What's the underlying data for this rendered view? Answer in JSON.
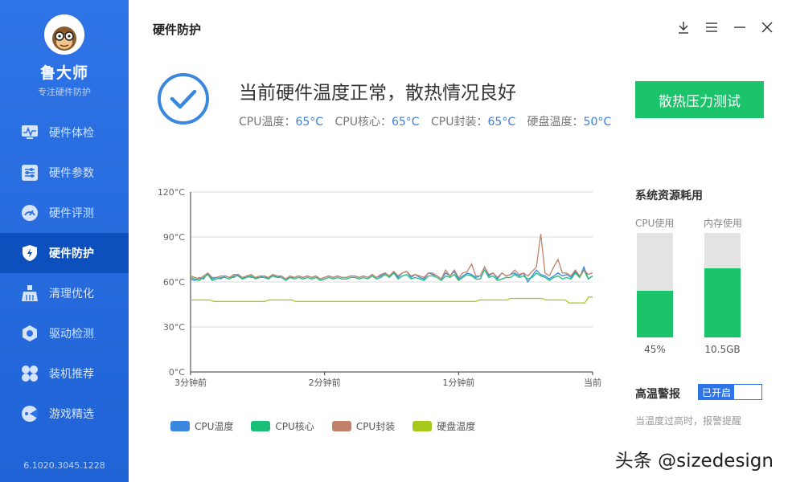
{
  "sidebar": {
    "app_name": "鲁大师",
    "app_subtitle": "专注硬件防护",
    "items": [
      {
        "label": "硬件体检",
        "icon": "monitor-icon"
      },
      {
        "label": "硬件参数",
        "icon": "sliders-icon"
      },
      {
        "label": "硬件评测",
        "icon": "gauge-icon"
      },
      {
        "label": "硬件防护",
        "icon": "shield-icon",
        "active": true
      },
      {
        "label": "清理优化",
        "icon": "broom-icon"
      },
      {
        "label": "驱动检测",
        "icon": "gear-icon"
      },
      {
        "label": "装机推荐",
        "icon": "grid-icon"
      },
      {
        "label": "游戏精选",
        "icon": "game-icon"
      }
    ],
    "version": "6.1020.3045.1228"
  },
  "header": {
    "title": "硬件防护"
  },
  "status": {
    "title": "当前硬件温度正常，散热情况良好",
    "temps": [
      {
        "label": "CPU温度：",
        "value": "65°C"
      },
      {
        "label": "CPU核心：",
        "value": "65°C"
      },
      {
        "label": "CPU封装：",
        "value": "65°C"
      },
      {
        "label": "硬盘温度：",
        "value": "50°C"
      }
    ],
    "stress_button": "散热压力测试"
  },
  "chart_data": {
    "type": "line",
    "y_ticks": [
      "120°C",
      "90°C",
      "60°C",
      "30°C",
      "0°C"
    ],
    "x_ticks": [
      "3分钟前",
      "2分钟前",
      "1分钟前",
      "当前"
    ],
    "ylim": [
      0,
      120
    ],
    "grid": true,
    "legend_position": "bottom",
    "series": [
      {
        "name": "CPU温度",
        "color": "#3a87e0",
        "values": [
          62,
          61,
          63,
          62,
          66,
          62,
          63,
          62,
          64,
          63,
          63,
          65,
          62,
          64,
          63,
          63,
          63,
          64,
          62,
          65,
          63,
          64,
          62,
          63,
          63,
          64,
          63,
          64,
          63,
          64,
          62,
          63,
          64,
          63,
          64,
          63,
          63,
          64,
          64,
          63,
          64,
          63,
          65,
          63,
          64,
          66,
          64,
          67,
          63,
          66,
          67,
          63,
          65,
          63,
          62,
          66,
          65,
          64,
          62,
          66,
          64,
          67,
          62,
          64,
          66,
          65,
          63,
          64,
          70,
          64,
          66,
          62,
          66,
          64,
          65,
          66,
          64,
          66,
          60,
          64,
          68,
          65,
          64,
          62,
          64,
          66,
          64,
          65,
          63,
          67,
          63,
          70,
          62,
          64
        ]
      },
      {
        "name": "CPU核心",
        "color": "#1bbf78",
        "values": [
          63,
          62,
          61,
          63,
          65,
          61,
          62,
          63,
          63,
          62,
          64,
          64,
          62,
          63,
          64,
          62,
          63,
          63,
          62,
          64,
          63,
          63,
          61,
          63,
          62,
          63,
          62,
          63,
          62,
          63,
          61,
          62,
          63,
          62,
          63,
          62,
          62,
          63,
          63,
          62,
          63,
          62,
          64,
          62,
          63,
          65,
          63,
          66,
          62,
          64,
          65,
          62,
          63,
          62,
          61,
          64,
          64,
          63,
          61,
          64,
          63,
          65,
          61,
          63,
          65,
          64,
          62,
          62,
          68,
          63,
          64,
          61,
          62,
          63,
          63,
          65,
          63,
          64,
          62,
          63,
          66,
          64,
          63,
          61,
          63,
          64,
          62,
          63,
          62,
          66,
          63,
          68,
          62,
          64
        ]
      },
      {
        "name": "CPU封装",
        "color": "#c0826a",
        "values": [
          64,
          63,
          62,
          64,
          66,
          63,
          63,
          64,
          64,
          63,
          65,
          65,
          63,
          64,
          65,
          63,
          64,
          64,
          63,
          65,
          64,
          64,
          62,
          64,
          63,
          64,
          63,
          64,
          63,
          64,
          62,
          63,
          64,
          63,
          64,
          63,
          63,
          64,
          64,
          63,
          64,
          63,
          65,
          63,
          65,
          66,
          64,
          67,
          64,
          66,
          67,
          64,
          65,
          64,
          63,
          66,
          66,
          64,
          62,
          68,
          64,
          68,
          63,
          66,
          67,
          72,
          64,
          64,
          70,
          65,
          66,
          63,
          66,
          64,
          65,
          68,
          65,
          66,
          64,
          67,
          70,
          92,
          66,
          64,
          70,
          75,
          66,
          66,
          64,
          68,
          64,
          68,
          65,
          66
        ]
      },
      {
        "name": "硬盘温度",
        "color": "#a7c91c",
        "values": [
          48,
          48,
          48,
          48,
          48,
          48,
          47,
          47,
          47,
          47,
          47,
          47,
          47,
          47,
          47,
          47,
          47,
          47,
          47,
          47,
          48,
          48,
          48,
          48,
          48,
          48,
          48,
          47,
          47,
          47,
          47,
          47,
          47,
          47,
          47,
          47,
          47,
          47,
          47,
          47,
          47,
          47,
          47,
          47,
          47,
          47,
          47,
          47,
          47,
          47,
          47,
          47,
          47,
          47,
          47,
          47,
          47,
          47,
          47,
          47,
          47,
          47,
          47,
          47,
          47,
          47,
          47,
          47,
          47,
          47,
          47,
          47,
          47,
          47,
          48,
          48,
          48,
          48,
          48,
          48,
          48,
          48,
          49,
          49,
          49,
          49,
          49,
          49,
          49,
          49,
          49,
          48,
          48,
          48,
          48,
          48,
          48,
          46,
          46,
          46,
          46,
          46,
          50,
          50
        ]
      }
    ]
  },
  "resources": {
    "title": "系统资源耗用",
    "cpu_label": "CPU使用",
    "cpu_value": "45%",
    "cpu_fraction": 0.45,
    "mem_label": "内存使用",
    "mem_value": "10.5GB",
    "mem_fraction": 0.66
  },
  "alarm": {
    "label": "高温警报",
    "toggle_text": "已开启",
    "desc": "当温度过高时，报警提醒"
  },
  "watermark": "头条 @sizedesign",
  "colors": {
    "sidebar": "#2f74e6",
    "accent": "#1bc46a",
    "active_nav": "#0d4fbd"
  }
}
